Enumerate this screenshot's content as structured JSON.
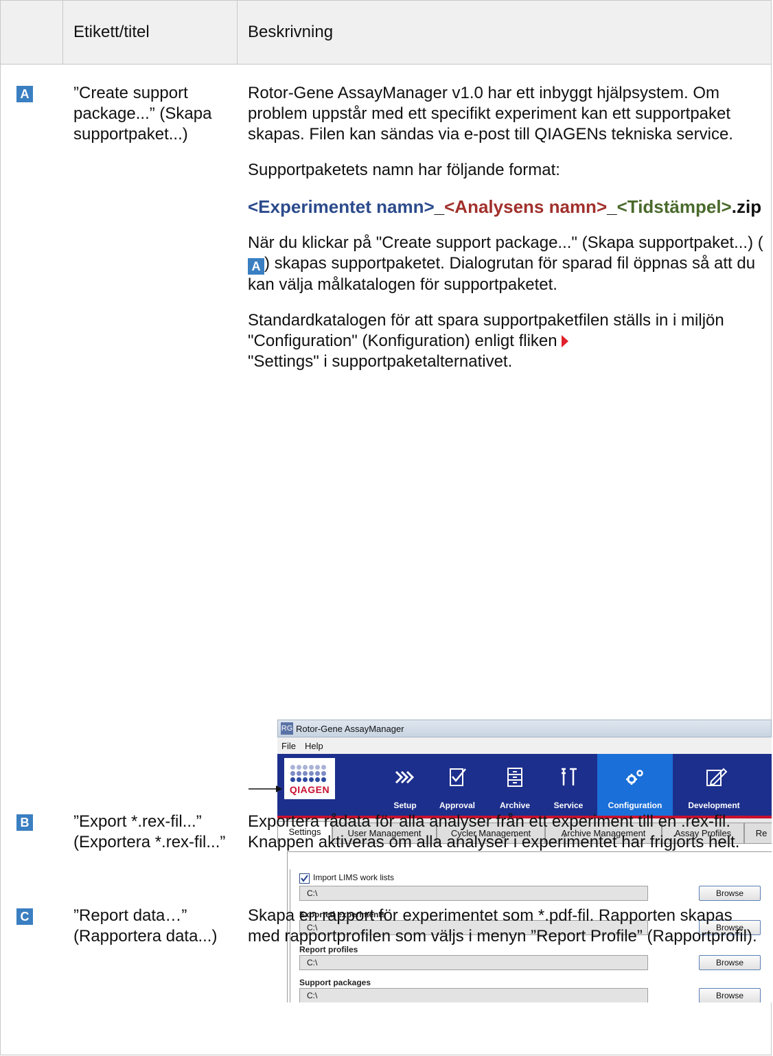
{
  "header": {
    "col_label": "Etikett/titel",
    "col_desc": "Beskrivning"
  },
  "rows": [
    {
      "badge": "A",
      "label": "”Create support package...” (Skapa supportpaket...)",
      "p1": "Rotor-Gene AssayManager v1.0 har ett inbyggt hjälpsystem. Om problem uppstår med ett specifikt experiment kan ett supportpaket skapas. Filen kan sändas via e-post till QIAGENs tekniska service.",
      "p2": "Supportpaketets namn har följande format:",
      "fmt_exp": "<Experimentet namn>",
      "fmt_us1": "_",
      "fmt_ana": "<Analysens namn>",
      "fmt_us2": "_",
      "fmt_ts": "<Tidstämpel>",
      "fmt_ext": ".zip",
      "p3_a": "När du klickar på \"Create support package...\" (Skapa supportpaket...) (",
      "p3_badge": "A",
      "p3_b": ") skapas supportpaketet. Dialogrutan för sparad fil öppnas så att du kan välja målkatalogen för supportpaketet.",
      "p4_a": "Standardkatalogen för att spara supportpaketfilen ställs in i miljön \"Configuration\" (Konfiguration) enligt fliken",
      "p4_b": "\"Settings\" i supportpaketalternativet."
    },
    {
      "badge": "B",
      "label": "”Export *.rex-fil...” (Exportera *.rex-fil...”",
      "p1": "Exportera rådata för alla analyser från ett experiment till en .rex-fil.",
      "p2": "Knappen aktiveras om alla analyser i experimentet har frigjorts helt."
    },
    {
      "badge": "C",
      "label": "”Report data…” (Rapportera data...)",
      "p1": "Skapa en rapport för experimentet som *.pdf-fil. Rapporten skapas med rapportprofilen som väljs i menyn ”Report Profile” (Rapportprofil)."
    }
  ],
  "screenshot": {
    "window_title": "Rotor-Gene AssayManager",
    "app_icon": "RG",
    "menu": [
      "File",
      "Help"
    ],
    "logo_text": "QIAGEN",
    "nav": [
      "Setup",
      "Approval",
      "Archive",
      "Service",
      "Configuration",
      "Development"
    ],
    "tabs": [
      "Settings",
      "User Management",
      "Cycler Management",
      "Archive Management",
      "Assay Profiles",
      "Re"
    ],
    "import_checkbox_label": "Import LIMS work lists",
    "import_checked": true,
    "fields": [
      {
        "label": "",
        "value": "C:\\",
        "button": "Browse"
      },
      {
        "label": "Exported experiments",
        "value": "C:\\",
        "button": "Browse"
      },
      {
        "label": "Report profiles",
        "value": "C:\\",
        "button": "Browse"
      },
      {
        "label": "Support packages",
        "value": "C:\\",
        "button": "Browse"
      }
    ]
  }
}
